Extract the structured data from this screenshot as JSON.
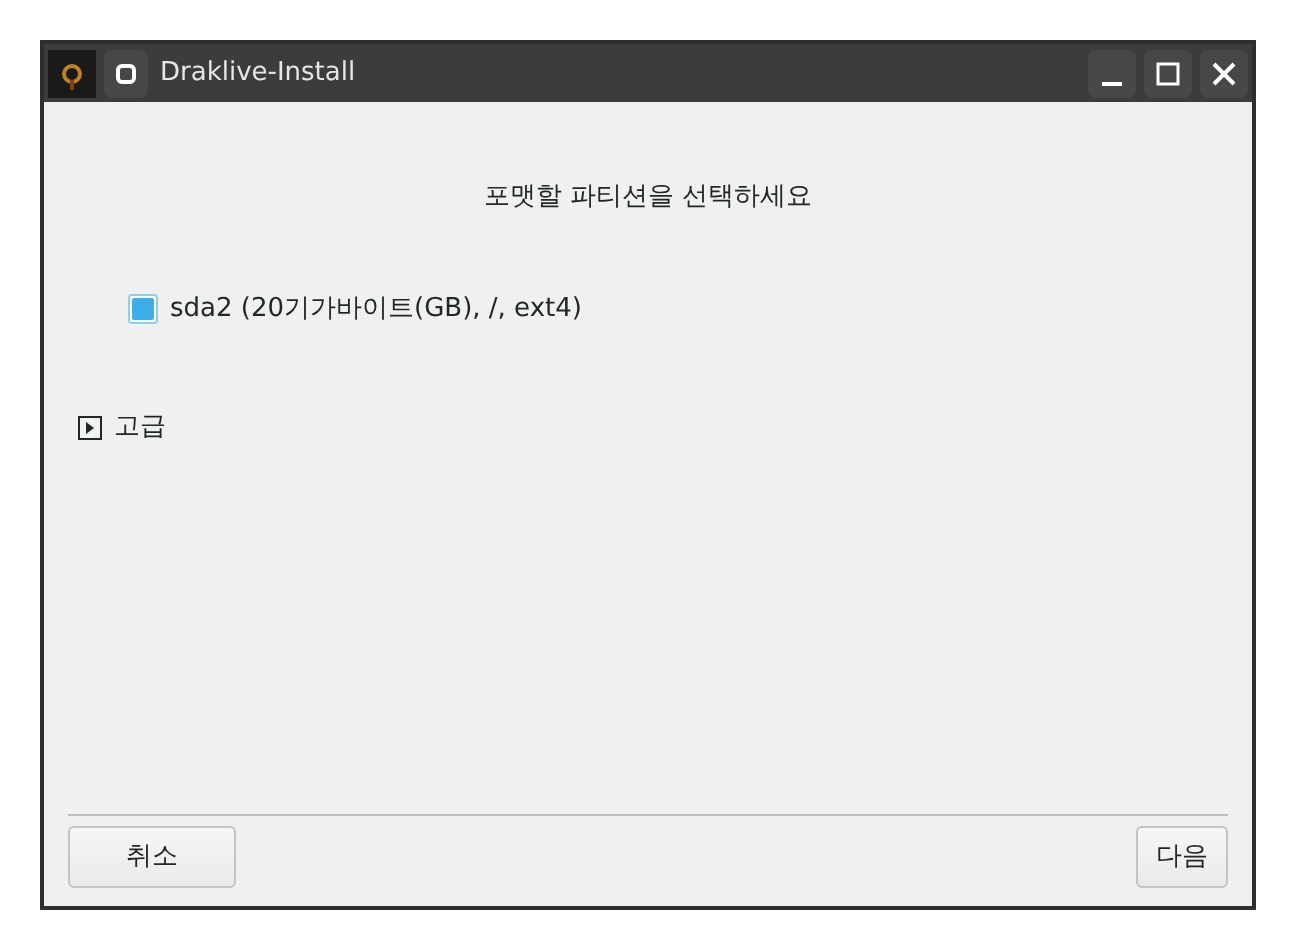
{
  "window": {
    "title": "Draklive-Install"
  },
  "heading": "포맷할 파티션을 선택하세요",
  "partitions": [
    {
      "label": "sda2 (20기가바이트(GB), /, ext4)",
      "checked": true
    }
  ],
  "advanced": {
    "label": "고급",
    "expanded": false
  },
  "buttons": [
    {
      "label": "취소",
      "kind": "cancel"
    },
    {
      "label": "다음",
      "kind": "next"
    }
  ]
}
